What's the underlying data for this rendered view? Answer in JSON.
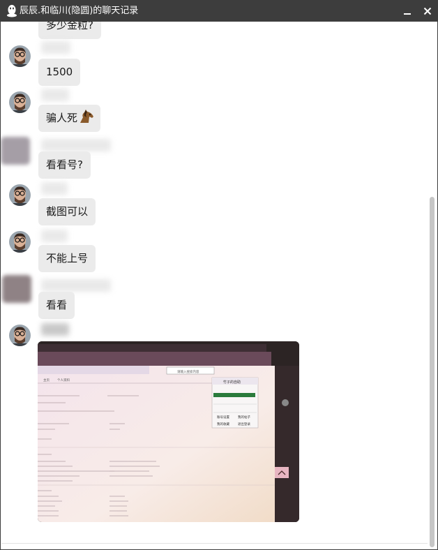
{
  "window": {
    "title": "辰辰.和临川(隐圆)的聊天记录",
    "app_icon": "qq-penguin-icon",
    "controls": {
      "minimize_icon": "minimize-icon",
      "close_icon": "close-icon"
    }
  },
  "messages": [
    {
      "sender": "other",
      "text": "多少金粒?"
    },
    {
      "sender": "me",
      "text": "1500"
    },
    {
      "sender": "me",
      "text": "骗人死",
      "emoji": "horse-emoji"
    },
    {
      "sender": "other",
      "text": "看看号?"
    },
    {
      "sender": "me",
      "text": "截图可以"
    },
    {
      "sender": "me",
      "text": "不能上号"
    },
    {
      "sender": "other",
      "text": "看看"
    },
    {
      "sender": "me",
      "type": "image",
      "description_icon": "screenshot-photo"
    }
  ],
  "photo": {
    "menu": {
      "title": "竹子的自助",
      "items": [
        "账号设置",
        "我的帖子",
        "我的收藏",
        "退出登录"
      ]
    },
    "search_placeholder": "请输入搜索内容",
    "tab_labels": [
      "主页",
      "个人资料"
    ]
  },
  "colors": {
    "titlebar": "#3d3d3d",
    "bubble": "#ebebeb",
    "scrollbar_thumb": "#c6c6c6"
  }
}
